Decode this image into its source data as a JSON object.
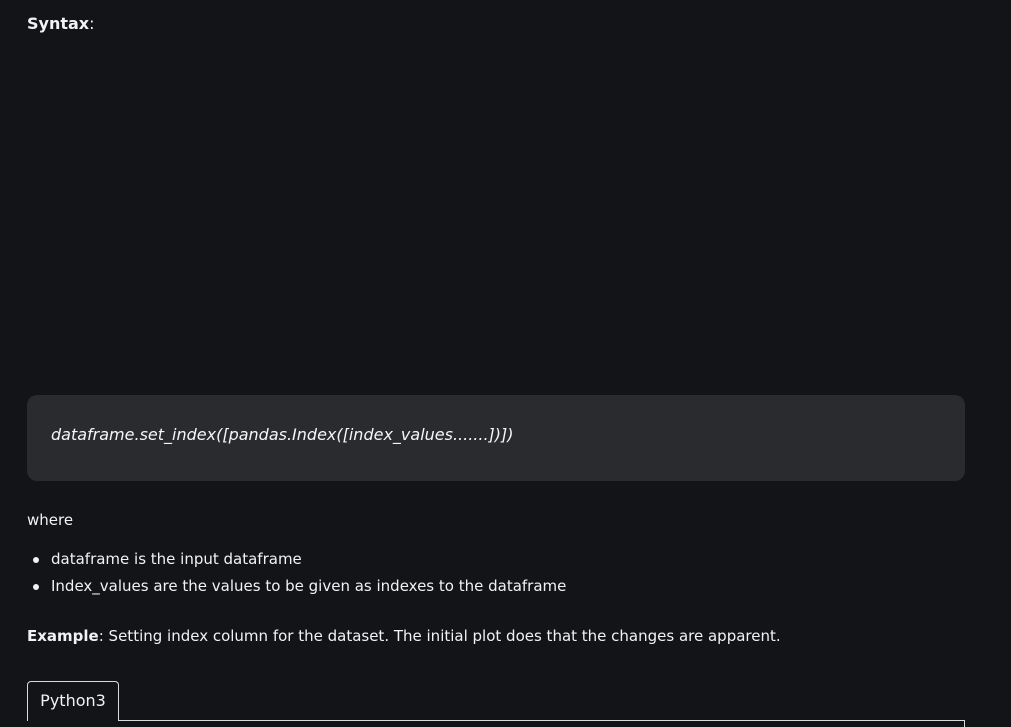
{
  "syntax": {
    "label": "Syntax",
    "colon": ":"
  },
  "code": {
    "text": "dataframe.set_index([pandas.Index([index_values.......])])"
  },
  "where": {
    "text": "where"
  },
  "bullets": [
    "dataframe is the input dataframe",
    "Index_values are the values to be given as indexes to the dataframe"
  ],
  "example": {
    "label": "Example",
    "text": ": Setting index column for the dataset. The initial plot does that the changes are apparent."
  },
  "tabs": [
    {
      "label": "Python3"
    }
  ]
}
